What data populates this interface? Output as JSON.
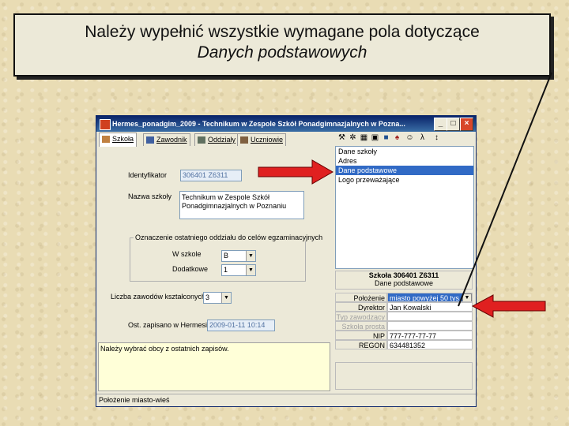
{
  "callout": {
    "line1": "Należy wypełnić wszystkie wymagane pola dotyczące",
    "line2": "Danych podstawowych"
  },
  "window": {
    "title": "Hermes_ponadgim_2009 - Technikum w Zespole Szkół Ponadgimnazjalnych w Pozna...",
    "tabs": [
      {
        "label": "Szkoła",
        "icon": "school-icon"
      },
      {
        "label": "Zawodnik",
        "icon": "book-icon"
      },
      {
        "label": "Oddziały",
        "icon": "class-icon"
      },
      {
        "label": "Uczniowie",
        "icon": "students-icon"
      }
    ],
    "form": {
      "identyfikator_label": "Identyfikator",
      "identyfikator_value": "306401 Z6311",
      "nazwa_label": "Nazwa szkoły",
      "nazwa_value": "Technikum w Zespole Szkół Ponadgimnazjalnych w Poznaniu",
      "group_caption": "Oznaczenie ostatniego oddziału do celów egzaminacyjnych",
      "w_szkole_label": "W szkole",
      "w_szkole_value": "B",
      "dodatkowe_label": "Dodatkowe",
      "dodatkowe_value": "1",
      "liczba_label": "Liczba zawodów kształconych",
      "liczba_value": "3",
      "ost_zapis_label": "Ost. zapisano w Hermesie",
      "ost_zapis_value": "2009-01-11 10:14"
    },
    "message": "Należy wybrać obcy z ostatnich zapisów.",
    "status": "Położenie miasto-wieś",
    "right_list": [
      "Dane szkoły",
      "Adres",
      "Dane podstawowe",
      "Logo przeważające"
    ],
    "right_list_selected": 2,
    "right_header": {
      "line1": "Szkoła 306401 Z6311",
      "line2": "Dane podstawowe"
    },
    "props": [
      {
        "label": "Położenie",
        "value": "miasto powyżej 50 tys.",
        "highlight": true,
        "dropdown": true,
        "disabled": false
      },
      {
        "label": "Dyrektor",
        "value": "Jan Kowalski",
        "highlight": false,
        "dropdown": false,
        "disabled": false
      },
      {
        "label": "Typ zawodzący",
        "value": "",
        "highlight": false,
        "dropdown": false,
        "disabled": true
      },
      {
        "label": "Szkoła prosta",
        "value": "",
        "highlight": false,
        "dropdown": false,
        "disabled": true
      },
      {
        "label": "NIP",
        "value": "777-777-77-77",
        "highlight": false,
        "dropdown": false,
        "disabled": false
      },
      {
        "label": "REGON",
        "value": "634481352",
        "highlight": false,
        "dropdown": false,
        "disabled": false
      }
    ],
    "toolbar_icons": [
      "tools-icon",
      "wrench-icon",
      "grid-icon",
      "panel-icon",
      "save-icon",
      "binoculars-icon",
      "person-icon",
      "lambda-icon",
      "sort-icon"
    ]
  },
  "colors": {
    "accent_arrow": "#e02020",
    "selection": "#316ac5",
    "title_bar": "#0a246a"
  }
}
